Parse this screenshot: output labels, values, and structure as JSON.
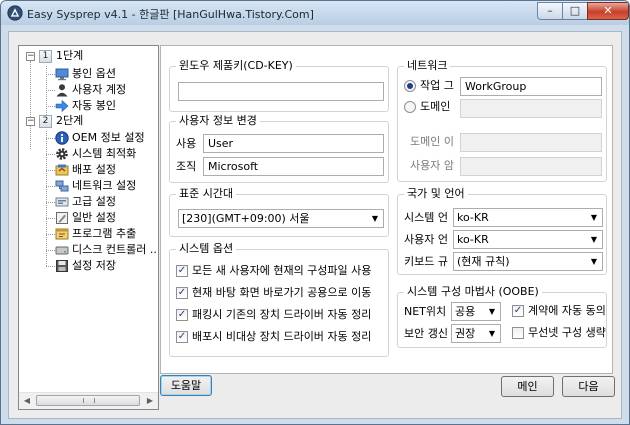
{
  "window": {
    "title": "Easy Sysprep v4.1 - 한글판 [HanGulHwa.Tistory.Com]"
  },
  "tree": {
    "step1": {
      "num": "1",
      "label": "1단계"
    },
    "step1_items": [
      {
        "label": "봉인 옵션",
        "icon": "monitor-icon"
      },
      {
        "label": "사용자 계정",
        "icon": "user-icon"
      },
      {
        "label": "자동 봉인",
        "icon": "arrow-right-icon"
      }
    ],
    "step2": {
      "num": "2",
      "label": "2단계"
    },
    "step2_items": [
      {
        "label": "OEM 정보 설정",
        "icon": "info-icon"
      },
      {
        "label": "시스템 최적화",
        "icon": "gear-icon"
      },
      {
        "label": "배포 설정",
        "icon": "deploy-icon"
      },
      {
        "label": "네트워크 설정",
        "icon": "network-icon"
      },
      {
        "label": "고급 설정",
        "icon": "advanced-icon"
      },
      {
        "label": "일반 설정",
        "icon": "general-icon"
      },
      {
        "label": "프로그램 추출",
        "icon": "program-icon"
      },
      {
        "label": "디스크 컨트롤러 ...",
        "icon": "disk-icon"
      },
      {
        "label": "설정 저장",
        "icon": "save-icon"
      }
    ]
  },
  "product_key": {
    "title": "윈도우 제품키(CD-KEY)",
    "value": ""
  },
  "user_info": {
    "title": "사용자 정보 변경",
    "user_label": "사용",
    "user_value": "User",
    "org_label": "조직",
    "org_value": "Microsoft"
  },
  "timezone": {
    "title": "표준 시간대",
    "value": "[230](GMT+09:00) 서울"
  },
  "system_options": {
    "title": "시스템 옵션",
    "items": [
      {
        "label": "모든 새 사용자에 현재의 구성파일 사용",
        "checked": true
      },
      {
        "label": "현재 바탕 화면 바로가기 공용으로 이동",
        "checked": true
      },
      {
        "label": "패킹시 기존의 장치 드라이버 자동 정리",
        "checked": true
      },
      {
        "label": "배포시 비대상 장치 드라이버 자동 정리",
        "checked": true
      }
    ]
  },
  "network": {
    "title": "네트워크",
    "workgroup_label": "작업 그",
    "workgroup_value": "WorkGroup",
    "domain_label": "도메인",
    "domain_name_label": "도메인 이",
    "domain_user_label": "사용자 암",
    "selected": "workgroup"
  },
  "locale": {
    "title": "국가 및 언어",
    "system_label": "시스템 언",
    "system_value": "ko-KR",
    "user_label": "사용자 언",
    "user_value": "ko-KR",
    "keyboard_label": "키보드 규",
    "keyboard_value": "(현재 규칙)"
  },
  "oobe": {
    "title": "시스템 구성 마법사 (OOBE)",
    "net_label": "NET위치",
    "net_value": "공용",
    "security_label": "보안 갱신",
    "security_value": "권장",
    "eula_label": "계약에 자동 동의",
    "eula_checked": true,
    "wireless_label": "무선넷 구성 생략",
    "wireless_checked": false
  },
  "buttons": {
    "help": "도움말",
    "main": "메인",
    "next": "다음"
  },
  "colors": {
    "check_mark": "#1e3f87",
    "title_bar": "#c9daee"
  }
}
